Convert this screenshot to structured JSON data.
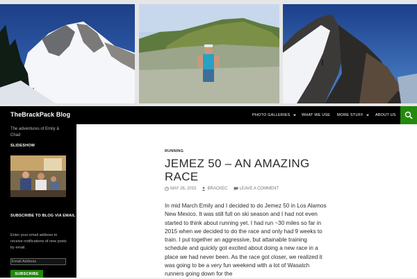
{
  "site": {
    "title": "TheBrackPack Blog",
    "tagline": "The adventures of Emily & Chad"
  },
  "header_images": [
    {
      "name": "snowy-mountain-ridge-photo"
    },
    {
      "name": "runner-in-sagebrush-photo"
    },
    {
      "name": "snowy-ridge-climber-photo"
    }
  ],
  "nav": {
    "items": [
      {
        "label": "PHOTO GALLERIES",
        "dropdown": true
      },
      {
        "label": "WHAT WE USE",
        "dropdown": false
      },
      {
        "label": "MORE STUFF",
        "dropdown": true
      },
      {
        "label": "ABOUT US",
        "dropdown": false
      }
    ],
    "search_icon": "search-icon",
    "accent_color": "#24890d"
  },
  "sidebar": {
    "slideshow_title": "SLIDESHOW",
    "subscribe_title": "SUBSCRIBE TO BLOG VIA EMAIL",
    "subscribe_text": "Enter your email address to receive notifications of new posts by email.",
    "email_placeholder": "Email Address",
    "subscribe_button": "SUBSCRIBE"
  },
  "post": {
    "category": "RUNNING",
    "title": "JEMEZ 50 – AN AMAZING RACE",
    "date": "MAY 26, 2015",
    "author": "BRACKEC",
    "comment_link": "LEAVE A COMMENT",
    "body": "In mid March Emily and I decided to do Jemez 50 in Los Alamos New Mexico. It was still full on ski season and I had not even started to think about running yet. I had run ~30 miles so far in 2015 when we decided to do the race and only had 9 weeks to train. I put together an aggressive, but attainable training schedule and quickly got excited about doing a new race in a place we had never been. As the race got closer, we realized it was going to be a very fun weekend with a lot of Wasatch runners going down for the"
  }
}
